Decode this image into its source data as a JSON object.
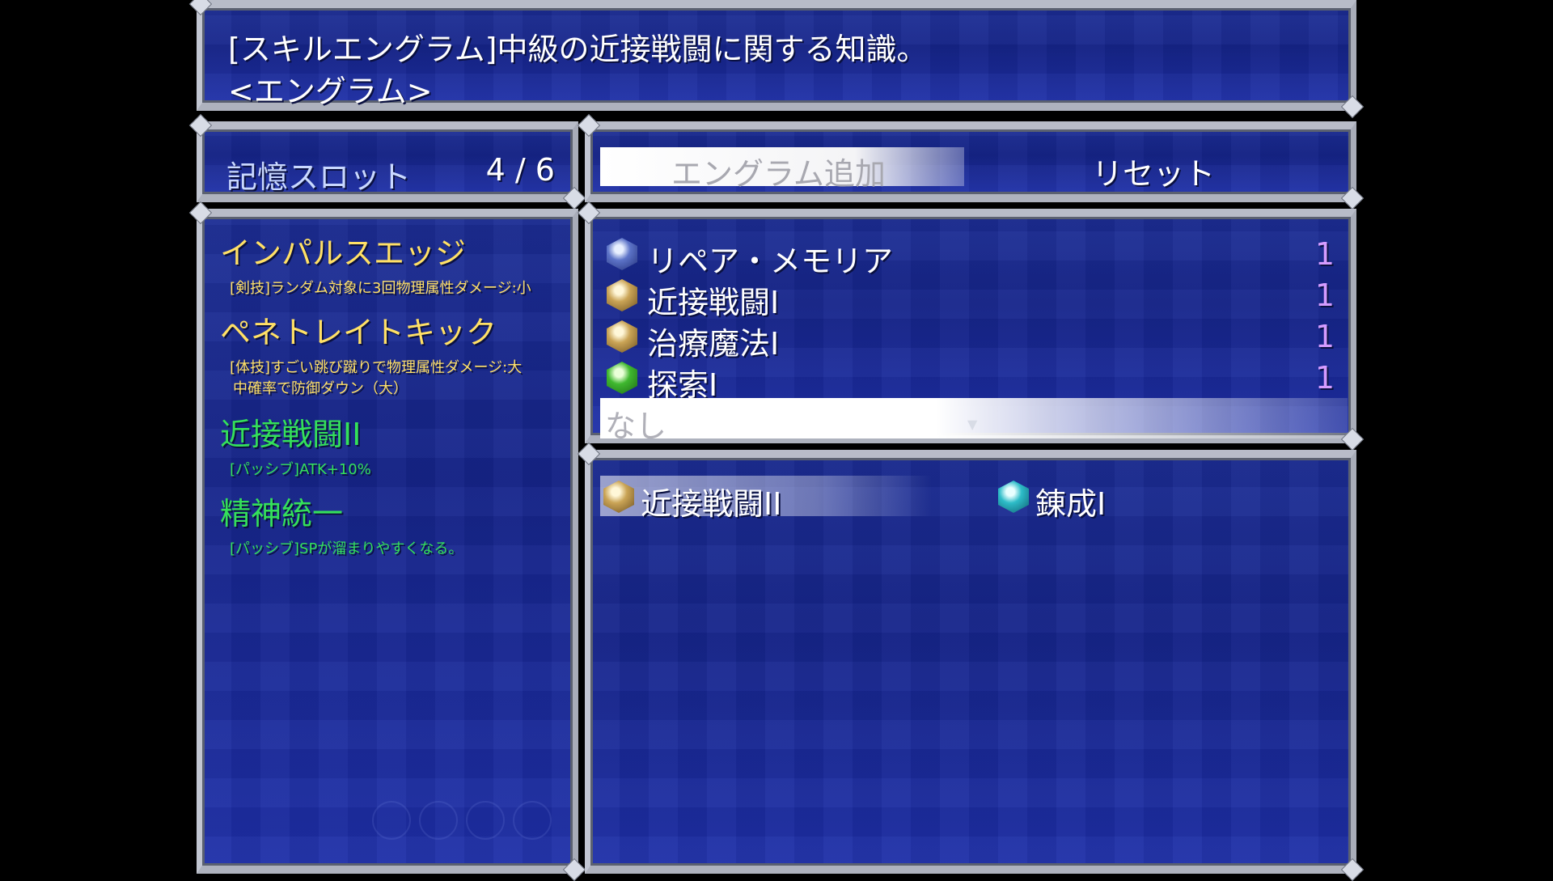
{
  "help": {
    "line1": "[スキルエングラム]中級の近接戦闘に関する知識。",
    "line2": "<エングラム>"
  },
  "slot": {
    "label": "記憶スロット",
    "value": "4 / 6"
  },
  "commands": {
    "add": "エングラム追加",
    "reset": "リセット"
  },
  "skills": [
    {
      "name": "インパルスエッジ",
      "desc": [
        "[剣技]ランダム対象に3回物理属性ダメージ:小"
      ],
      "color": "#ffe066"
    },
    {
      "name": "ペネトレイトキック",
      "desc": [
        "[体技]すごい跳び蹴りで物理属性ダメージ:大",
        "中確率で防御ダウン（大）"
      ],
      "color": "#ffe066"
    },
    {
      "name": "近接戦闘II",
      "desc": [
        "[パッシブ]ATK+10%"
      ],
      "color": "#34e05a"
    },
    {
      "name": "精神統一",
      "desc": [
        "[パッシブ]SPが溜まりやすくなる。"
      ],
      "color": "#34e05a"
    }
  ],
  "engram_list": [
    {
      "name": "リペア・メモリア",
      "count": "1",
      "icon": "blue-gem-icon"
    },
    {
      "name": "近接戦闘I",
      "count": "1",
      "icon": "gold-gem-icon"
    },
    {
      "name": "治療魔法I",
      "count": "1",
      "icon": "gold-gem-icon"
    },
    {
      "name": "探索I",
      "count": "1",
      "icon": "green-gem-icon"
    }
  ],
  "none_label": "なし",
  "owned": [
    {
      "name": "近接戦闘II",
      "icon": "gold-gem-icon"
    },
    {
      "name": "錬成I",
      "icon": "cyan-gem-icon"
    }
  ]
}
